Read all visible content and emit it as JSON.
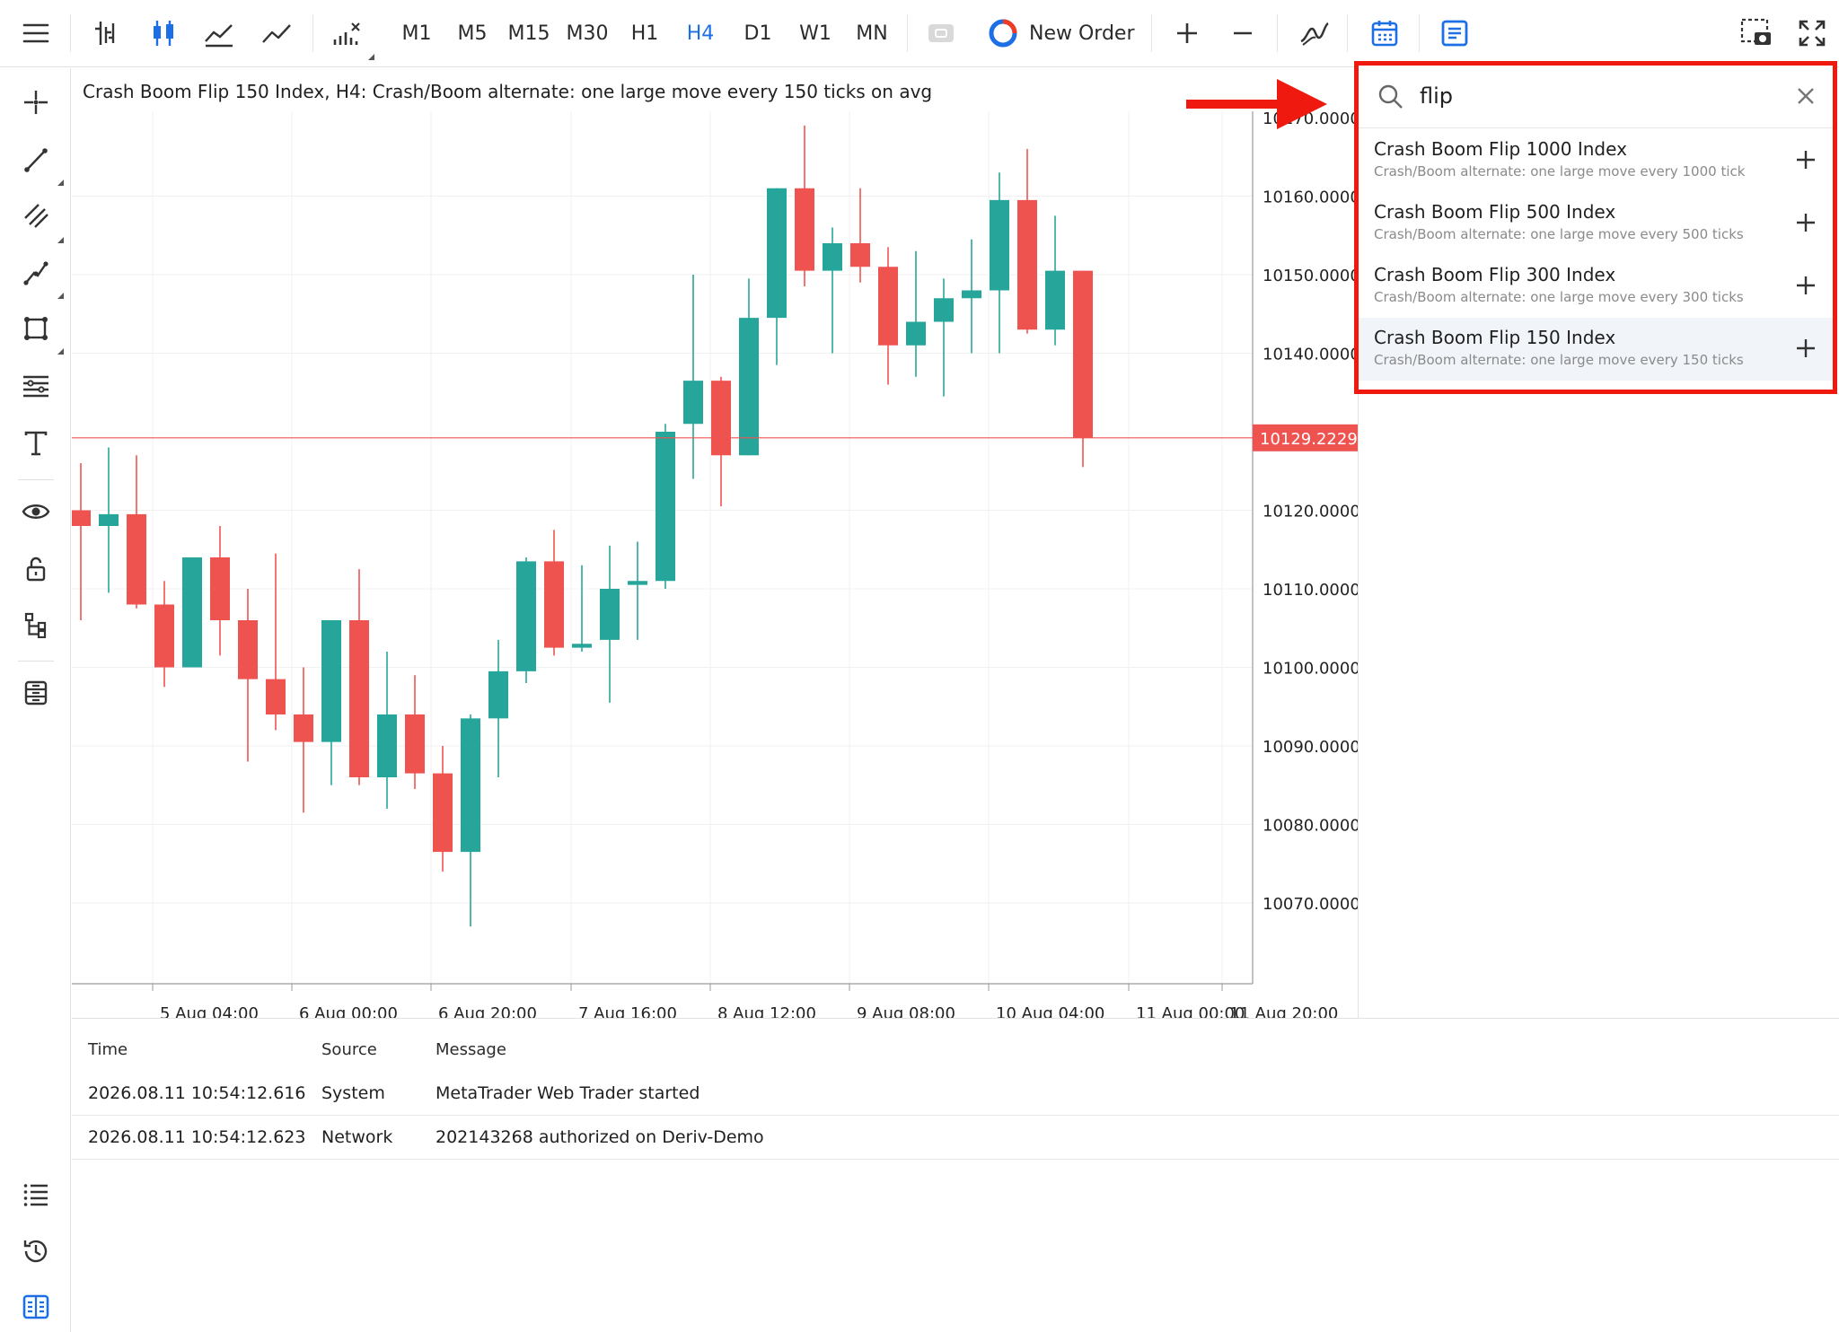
{
  "toolbar": {
    "timeframes": [
      {
        "label": "M1",
        "active": false
      },
      {
        "label": "M5",
        "active": false
      },
      {
        "label": "M15",
        "active": false
      },
      {
        "label": "M30",
        "active": false
      },
      {
        "label": "H1",
        "active": false
      },
      {
        "label": "H4",
        "active": true
      },
      {
        "label": "D1",
        "active": false
      },
      {
        "label": "W1",
        "active": false
      },
      {
        "label": "MN",
        "active": false
      }
    ],
    "new_order_label": "New Order"
  },
  "chart": {
    "title": "Crash Boom Flip 150 Index, H4: Crash/Boom alternate: one large move every 150 ticks on avg",
    "current_price_label": "10129.2229",
    "colors": {
      "bull": "#26a69a",
      "bear": "#ef5350",
      "price_line": "#ef5350"
    }
  },
  "chart_data": {
    "type": "candlestick",
    "symbol": "Crash Boom Flip 150 Index",
    "timeframe": "H4",
    "y_ticks": [
      10160,
      10150,
      10140,
      10120,
      10110,
      10100,
      10090,
      10080,
      10070
    ],
    "y_tick_labels": [
      "10160.0000",
      "10150.0000",
      "10140.0000",
      "10120.0000",
      "10110.0000",
      "10100.0000",
      "10090.0000",
      "10080.0000",
      "10070.0000"
    ],
    "x_tick_labels": [
      "5 Aug 04:00",
      "6 Aug 00:00",
      "6 Aug 20:00",
      "7 Aug 16:00",
      "8 Aug 12:00",
      "9 Aug 08:00",
      "10 Aug 04:00",
      "11 Aug 00:00",
      "11 Aug 20:00"
    ],
    "current_price": 10129.2229,
    "candles": [
      {
        "o": 10120.0,
        "h": 10126.0,
        "l": 10106.0,
        "c": 10118.0
      },
      {
        "o": 10118.0,
        "h": 10128.0,
        "l": 10109.5,
        "c": 10119.5
      },
      {
        "o": 10119.5,
        "h": 10127.0,
        "l": 10107.5,
        "c": 10108.0
      },
      {
        "o": 10108.0,
        "h": 10111.0,
        "l": 10097.5,
        "c": 10100.0
      },
      {
        "o": 10100.0,
        "h": 10114.0,
        "l": 10100.0,
        "c": 10114.0
      },
      {
        "o": 10114.0,
        "h": 10118.0,
        "l": 10101.5,
        "c": 10106.0
      },
      {
        "o": 10106.0,
        "h": 10110.0,
        "l": 10088.0,
        "c": 10098.5
      },
      {
        "o": 10098.5,
        "h": 10114.5,
        "l": 10092.0,
        "c": 10094.0
      },
      {
        "o": 10094.0,
        "h": 10100.0,
        "l": 10081.5,
        "c": 10090.5
      },
      {
        "o": 10090.5,
        "h": 10106.0,
        "l": 10085.0,
        "c": 10106.0
      },
      {
        "o": 10106.0,
        "h": 10112.5,
        "l": 10085.0,
        "c": 10086.0
      },
      {
        "o": 10086.0,
        "h": 10102.0,
        "l": 10082.0,
        "c": 10094.0
      },
      {
        "o": 10094.0,
        "h": 10099.0,
        "l": 10084.5,
        "c": 10086.5
      },
      {
        "o": 10086.5,
        "h": 10090.0,
        "l": 10074.0,
        "c": 10076.5
      },
      {
        "o": 10076.5,
        "h": 10094.0,
        "l": 10067.0,
        "c": 10093.5
      },
      {
        "o": 10093.5,
        "h": 10103.5,
        "l": 10086.0,
        "c": 10099.5
      },
      {
        "o": 10099.5,
        "h": 10114.0,
        "l": 10098.0,
        "c": 10113.5
      },
      {
        "o": 10113.5,
        "h": 10117.5,
        "l": 10101.5,
        "c": 10102.5
      },
      {
        "o": 10102.5,
        "h": 10113.0,
        "l": 10102.0,
        "c": 10103.0
      },
      {
        "o": 10103.5,
        "h": 10115.5,
        "l": 10095.5,
        "c": 10110.0
      },
      {
        "o": 10110.5,
        "h": 10116.0,
        "l": 10103.5,
        "c": 10111.0
      },
      {
        "o": 10111.0,
        "h": 10131.0,
        "l": 10110.0,
        "c": 10130.0
      },
      {
        "o": 10131.0,
        "h": 10150.0,
        "l": 10124.0,
        "c": 10136.5
      },
      {
        "o": 10136.5,
        "h": 10137.0,
        "l": 10120.5,
        "c": 10127.0
      },
      {
        "o": 10127.0,
        "h": 10149.5,
        "l": 10127.0,
        "c": 10144.5
      },
      {
        "o": 10144.5,
        "h": 10161.0,
        "l": 10138.5,
        "c": 10161.0
      },
      {
        "o": 10161.0,
        "h": 10169.0,
        "l": 10148.5,
        "c": 10150.5
      },
      {
        "o": 10150.5,
        "h": 10156.0,
        "l": 10140.0,
        "c": 10154.0
      },
      {
        "o": 10154.0,
        "h": 10161.0,
        "l": 10149.0,
        "c": 10151.0
      },
      {
        "o": 10151.0,
        "h": 10153.5,
        "l": 10136.0,
        "c": 10141.0
      },
      {
        "o": 10141.0,
        "h": 10153.0,
        "l": 10137.0,
        "c": 10144.0
      },
      {
        "o": 10144.0,
        "h": 10149.5,
        "l": 10134.5,
        "c": 10147.0
      },
      {
        "o": 10147.0,
        "h": 10154.5,
        "l": 10140.0,
        "c": 10148.0
      },
      {
        "o": 10148.0,
        "h": 10163.0,
        "l": 10140.0,
        "c": 10159.5
      },
      {
        "o": 10159.5,
        "h": 10166.0,
        "l": 10142.5,
        "c": 10143.0
      },
      {
        "o": 10143.0,
        "h": 10157.5,
        "l": 10141.0,
        "c": 10150.5
      },
      {
        "o": 10150.5,
        "h": 10150.5,
        "l": 10125.5,
        "c": 10129.2
      }
    ]
  },
  "journal": {
    "headers": {
      "time": "Time",
      "source": "Source",
      "message": "Message"
    },
    "rows": [
      {
        "time": "2026.08.11 10:54:12.616",
        "source": "System",
        "message": "MetaTrader Web Trader started"
      },
      {
        "time": "2026.08.11 10:54:12.623",
        "source": "Network",
        "message": "202143268 authorized on Deriv-Demo"
      }
    ]
  },
  "search": {
    "query": "flip",
    "results": [
      {
        "name": "Crash Boom Flip 1000 Index",
        "description": "Crash/Boom alternate: one large move every 1000 tick",
        "highlighted": false
      },
      {
        "name": "Crash Boom Flip 500 Index",
        "description": "Crash/Boom alternate: one large move every 500 ticks",
        "highlighted": false
      },
      {
        "name": "Crash Boom Flip 300 Index",
        "description": "Crash/Boom alternate: one large move every 300 ticks",
        "highlighted": false
      },
      {
        "name": "Crash Boom Flip 150 Index",
        "description": "Crash/Boom alternate: one large move every 150 ticks",
        "highlighted": true
      }
    ]
  },
  "annotation": {
    "highlight_color": "#f0190f"
  }
}
